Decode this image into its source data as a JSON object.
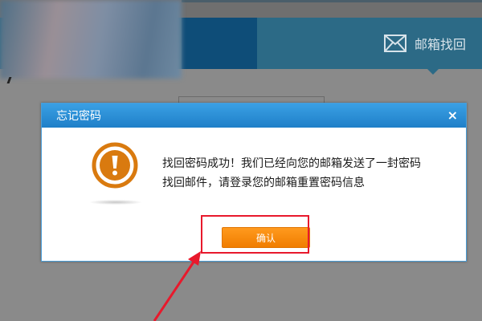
{
  "background": {
    "tab_label": "邮箱找回"
  },
  "dialog": {
    "title": "忘记密码",
    "close_glyph": "×",
    "message": "找回密码成功！我们已经向您的邮箱发送了一封密码找回邮件，请登录您的邮箱重置密码信息",
    "confirm_label": "确认",
    "icon": "warning-exclamation-icon"
  },
  "colors": {
    "header": "#1f7fc8",
    "button": "#f7890c",
    "icon": "#d97a0f",
    "annotation": "#e8192c"
  }
}
